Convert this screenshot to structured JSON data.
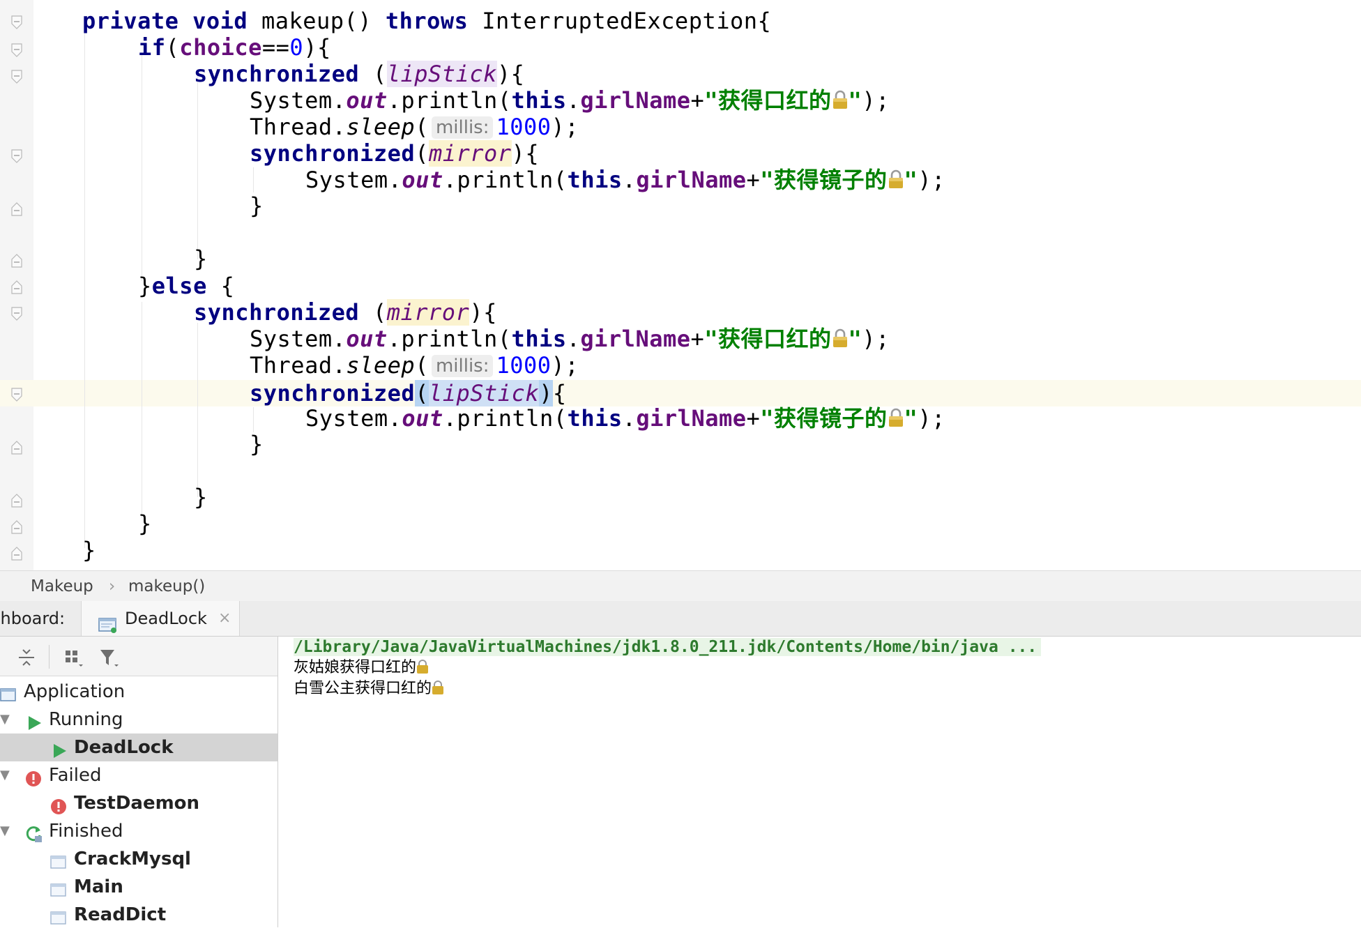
{
  "editor": {
    "sig_private": "private",
    "sig_void": "void",
    "sig_method": "makeup()",
    "sig_throws": "throws",
    "sig_exc": "InterruptedException{",
    "if_kw": "if",
    "if_open": "(",
    "choice": "choice",
    "eq": "==",
    "zero": "0",
    "if_close": "){",
    "sync_kw": "synchronized",
    "space_paren": " (",
    "paren": "(",
    "close_brace_open": "){",
    "lipstick": "lipStick",
    "mirror": "mirror",
    "system": "System.",
    "out": "out",
    "println": ".println(",
    "this_kw": "this",
    "dot": ".",
    "girl_name": "girlName",
    "plus": "+",
    "str_lipstick": "\"获得口红的",
    "str_mirror": "\"获得镜子的",
    "quote": "\"",
    "end_call": ");",
    "thread": "Thread.",
    "sleep": "sleep",
    "sleep_open": "(",
    "hint_millis": "millis:",
    "sleep_val": "1000",
    "brace": "}",
    "else_kw": "else",
    "else_rest": " {",
    "open_brace": "{",
    "close_paren": ")"
  },
  "breadcrumb": {
    "class_name": "Makeup",
    "separator": "›",
    "method_name": "makeup()"
  },
  "run_panel": {
    "dashboard_label": "shboard:",
    "tab_label": "DeadLock",
    "tab_close": "×"
  },
  "tree": {
    "application": "Application",
    "running": "Running",
    "deadlock": "DeadLock",
    "failed": "Failed",
    "test_daemon": "TestDaemon",
    "finished": "Finished",
    "crack_mysql": "CrackMysql",
    "main": "Main",
    "read_dict": "ReadDict",
    "arrow_expanded": "▼"
  },
  "console": {
    "command": "/Library/Java/JavaVirtualMachines/jdk1.8.0_211.jdk/Contents/Home/bin/java ...",
    "line1": "灰姑娘获得口红的",
    "line2": "白雪公主获得口红的"
  },
  "colors": {
    "keyword": "#000080",
    "field": "#660e7a",
    "string": "#008000",
    "number": "#0000ff",
    "running_green": "#3aa757",
    "failed_red": "#e05555"
  }
}
